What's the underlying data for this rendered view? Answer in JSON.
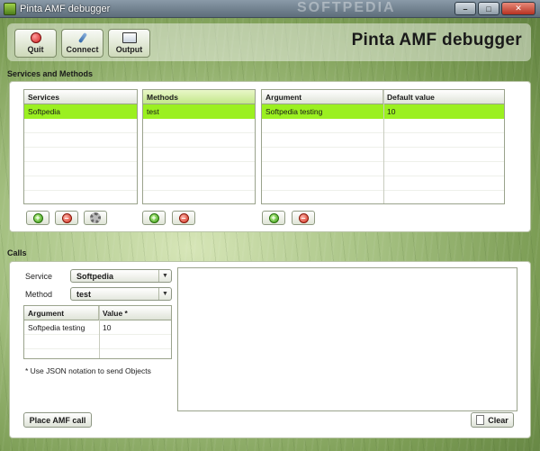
{
  "window": {
    "title": "Pinta AMF debugger",
    "watermark": "SOFTPEDIA",
    "controls": {
      "minimize": "–",
      "maximize": "□",
      "close": "✕"
    }
  },
  "toolbar": {
    "quit_label": "Quit",
    "connect_label": "Connect",
    "output_label": "Output",
    "heading": "Pinta AMF debugger",
    "icons": {
      "quit": "red-circle-icon",
      "connect": "plug-icon",
      "output": "screen-icon"
    }
  },
  "services_methods": {
    "title": "Services and Methods",
    "services": {
      "header": "Services",
      "rows": [
        "Softpedia"
      ]
    },
    "methods": {
      "header": "Methods",
      "rows": [
        "test"
      ]
    },
    "arguments": {
      "headers": [
        "Argument",
        "Default value"
      ],
      "rows": [
        [
          "Softpedia testing",
          "10"
        ]
      ]
    }
  },
  "calls": {
    "title": "Calls",
    "service_label": "Service",
    "service_value": "Softpedia",
    "method_label": "Method",
    "method_value": "test",
    "args": {
      "headers": [
        "Argument",
        "Value *"
      ],
      "rows": [
        [
          "Softpedia testing",
          "10"
        ]
      ]
    },
    "note": "* Use JSON notation to send Objects",
    "place_button": "Place AMF call",
    "clear_button": "Clear"
  },
  "colors": {
    "selection": "#9bf020",
    "accent_header": "#c3e88a"
  }
}
